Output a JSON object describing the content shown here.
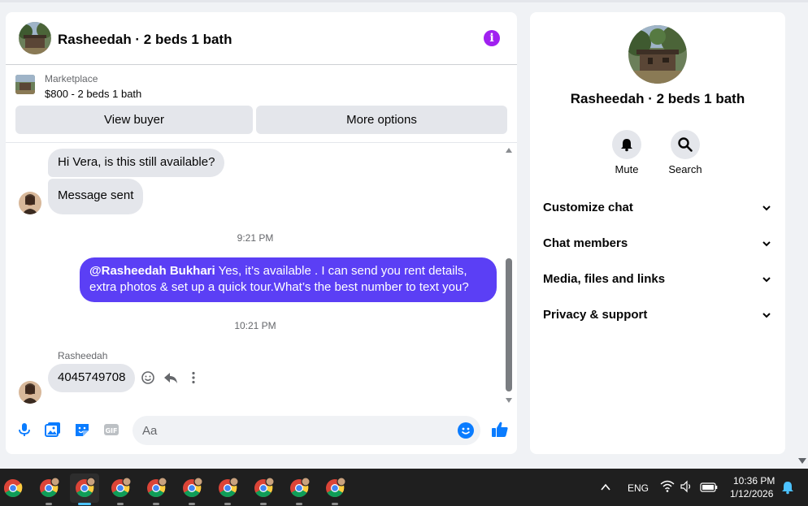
{
  "chat": {
    "title": "Rasheedah · 2 beds 1 bath",
    "listing": {
      "source": "Marketplace",
      "price_line": "$800 - 2 beds 1 bath",
      "view_buyer_label": "View buyer",
      "more_options_label": "More options"
    },
    "messages": {
      "incoming_1": "Hi Vera, is this still available?",
      "incoming_2": "Message sent",
      "time_1": "9:21 PM",
      "outgoing_mention": "@Rasheedah Bukhari",
      "outgoing_text": " Yes, it’s available .  I can send you rent details, extra photos & set up a quick tour.What’s the best number to text you?",
      "time_2": "10:21 PM",
      "sender": "Rasheedah",
      "incoming_3": "4045749708"
    },
    "composer": {
      "placeholder": "Aa"
    }
  },
  "info_panel": {
    "name": "Rasheedah · 2 beds 1 bath",
    "mute_label": "Mute",
    "search_label": "Search",
    "sections": [
      "Customize chat",
      "Chat members",
      "Media, files and links",
      "Privacy & support"
    ]
  },
  "taskbar": {
    "language": "ENG",
    "time": "10:36 PM",
    "date": "1/12/2026"
  },
  "colors": {
    "accent": "#0a7cff",
    "outgoing_bubble": "#5b3ff5",
    "info_icon": "#a020f0"
  }
}
